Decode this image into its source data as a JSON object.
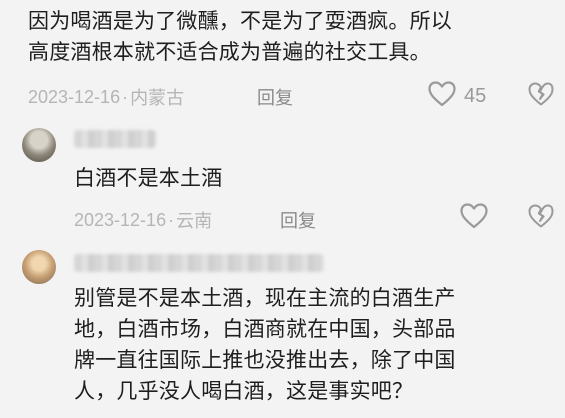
{
  "comments": [
    {
      "text_line1": "因为喝酒是为了微醺，不是为了耍酒疯。所以",
      "text_line2": "高度酒根本就不适合成为普遍的社交工具。",
      "date": "2023-12-16",
      "separator": "·",
      "location": "内蒙古",
      "reply_label": "回复",
      "likes": "45"
    },
    {
      "text": "白酒不是本土酒",
      "date": "2023-12-16",
      "separator": "·",
      "location": "云南",
      "reply_label": "回复"
    },
    {
      "text_line1": "别管是不是本土酒，现在主流的白酒生产",
      "text_line2": "地，白酒市场，白酒商就在中国，头部品",
      "text_line3": "牌一直往国际上推也没推出去，除了中国",
      "text_line4": "人，几乎没人喝白酒，这是事实吧？"
    }
  ],
  "icons": {
    "like": "heart-icon",
    "dislike": "broken-heart-icon"
  },
  "colors": {
    "background": "#f3f3f3",
    "text": "#1e1e1e",
    "meta": "#b5b5b5",
    "reply": "#8a8a8a",
    "icon": "#9a9a9a"
  }
}
